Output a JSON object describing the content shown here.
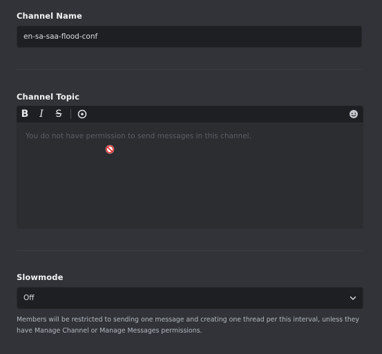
{
  "channel_name": {
    "label": "Channel Name",
    "value": "en-sa-saa-flood-conf"
  },
  "channel_topic": {
    "label": "Channel Topic",
    "toolbar": {
      "bold": "B",
      "italic": "I",
      "strikethrough": "S"
    },
    "placeholder": "You do not have permission to send messages in this channel."
  },
  "slowmode": {
    "label": "Slowmode",
    "selected": "Off",
    "help": "Members will be restricted to sending one message and creating one thread per this interval, unless they have Manage Channel or Manage Messages permissions."
  },
  "icons": {
    "spoiler": "eye-icon",
    "emoji": "emoji-icon",
    "cursor": "no-entry-cursor-icon",
    "dropdown": "chevron-down-icon"
  },
  "colors": {
    "background": "#313338",
    "input_background": "#1e1f22",
    "editor_background": "#2b2d31",
    "cursor_red": "#e03131"
  }
}
